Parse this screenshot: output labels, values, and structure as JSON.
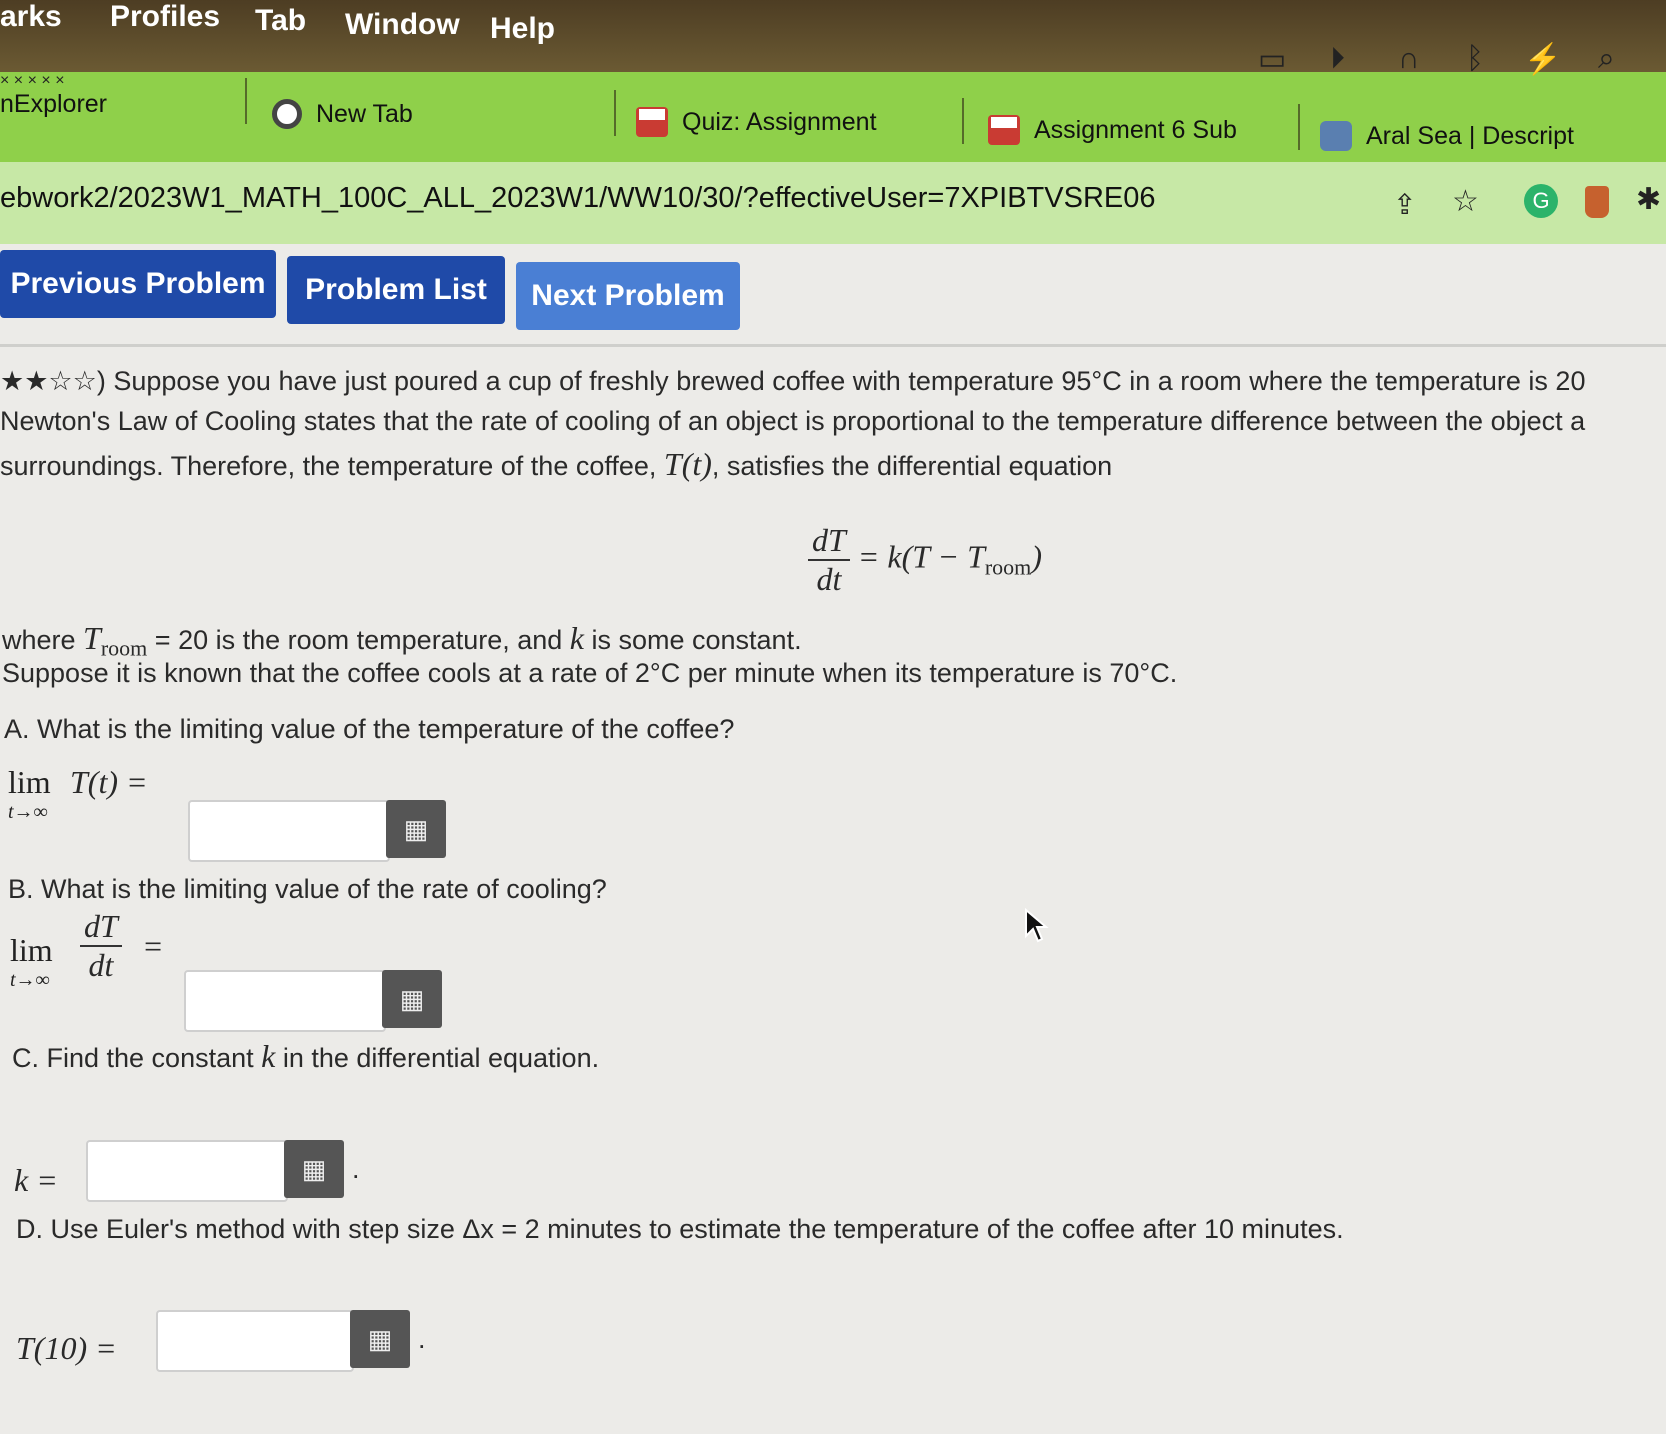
{
  "menubar": {
    "items": [
      "arks",
      "Profiles",
      "Tab",
      "Window",
      "Help"
    ]
  },
  "status_icons": [
    "display-icon",
    "play-icon",
    "headphones-icon",
    "bluetooth-icon",
    "battery-icon",
    "search-icon"
  ],
  "tabs": [
    {
      "label": "nExplorer"
    },
    {
      "label": "New Tab"
    },
    {
      "label": "Quiz: Assignment"
    },
    {
      "label": "Assignment 6 Sub"
    },
    {
      "label": "Aral Sea | Descript"
    }
  ],
  "omnibox": {
    "url": "ebwork2/2023W1_MATH_100C_ALL_2023W1/WW10/30/?effectiveUser=7XPIBTVSRE06"
  },
  "nav": {
    "previous": "Previous Problem",
    "list": "Problem List",
    "next": "Next Problem"
  },
  "problem": {
    "stars": "★★☆☆)",
    "line1": "Suppose you have just poured a cup of freshly brewed coffee with temperature 95°C in a room where the temperature is 20",
    "line2": "Newton's Law of Cooling states that the rate of cooling of an object is proportional to the temperature difference between the object a",
    "line3a": "surroundings. Therefore, the temperature of the coffee, ",
    "line3_T": "T(t)",
    "line3b": ", satisfies the differential equation",
    "eq_num": "dT",
    "eq_den": "dt",
    "eq_rhs": "= k(T − T",
    "eq_sub": "room",
    "eq_close": ")",
    "where_a": "where ",
    "where_T": "T",
    "where_sub": "room",
    "where_b": " = 20 is the room temperature, and ",
    "where_k": "k",
    "where_c": " is some constant.",
    "rate_line": "Suppose it is known that the coffee cools at a rate of 2°C per minute when its temperature is 70°C."
  },
  "parts": {
    "a_q": "A. What is the limiting value of the temperature of the coffee?",
    "a_lim": "lim",
    "a_sub": "t→∞",
    "a_expr": "T(t) =",
    "b_q": "B. What is the limiting value of the rate of cooling?",
    "b_lim": "lim",
    "b_sub": "t→∞",
    "b_num": "dT",
    "b_den": "dt",
    "b_eq": "=",
    "c_q": "C. Find the constant ",
    "c_k": "k",
    "c_q2": " in the differential equation.",
    "c_expr": "k =",
    "c_dot": ".",
    "d_q": "D. Use Euler's method with step size Δx = 2 minutes to estimate the temperature of the coffee after 10 minutes.",
    "d_expr": "T(10) =",
    "d_dot": "."
  },
  "keyboard_icon": "▦",
  "colors": {
    "tab_strip": "#8fd04a",
    "omnibox": "#c7e8a6",
    "btn_dark": "#1f4aa8",
    "btn_light": "#4a7fd4"
  }
}
